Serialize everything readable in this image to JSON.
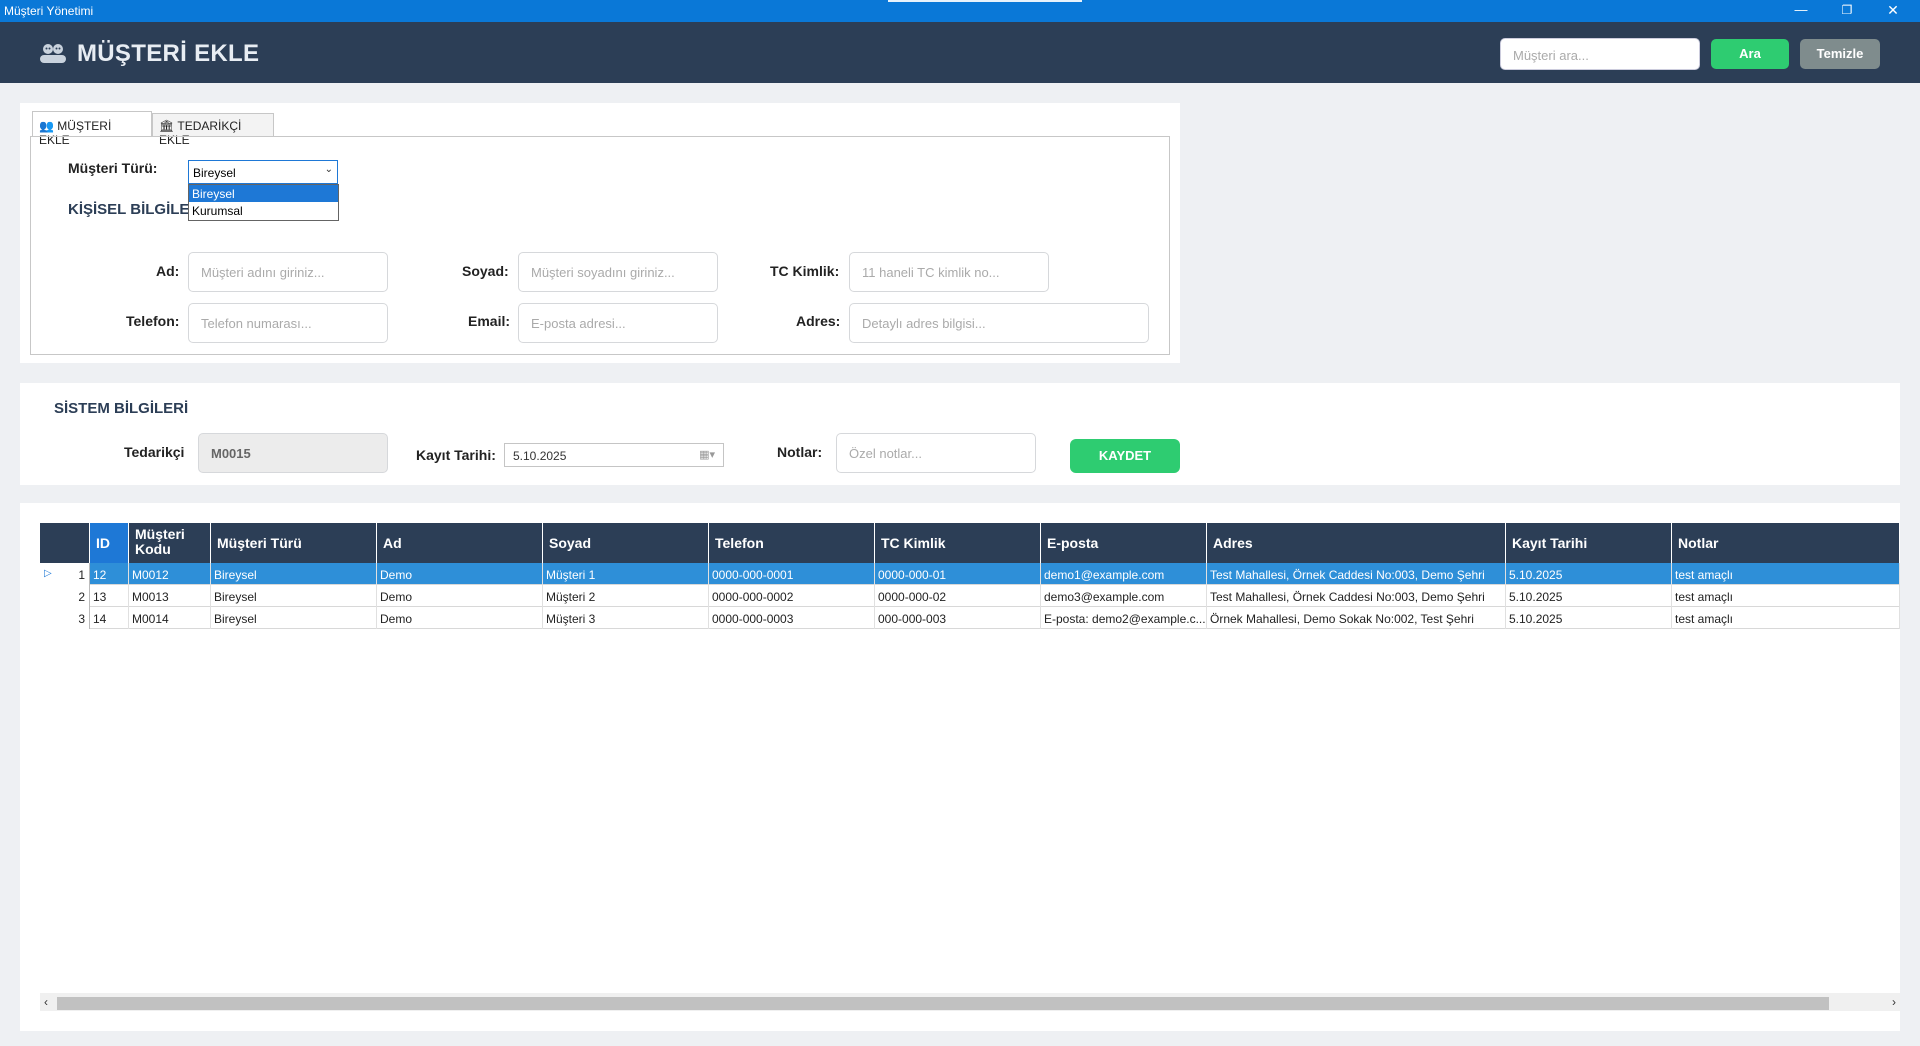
{
  "window": {
    "title": "Müşteri Yönetimi",
    "minimize": "—",
    "maximize": "❐",
    "close": "✕"
  },
  "header": {
    "title": "MÜŞTERİ EKLE",
    "search_placeholder": "Müşteri ara...",
    "search_button": "Ara",
    "clear_button": "Temizle"
  },
  "tabs": [
    {
      "label": "MÜŞTERİ EKLE",
      "active": true
    },
    {
      "label": "TEDARİKÇİ EKLE",
      "active": false
    }
  ],
  "form": {
    "customer_type_label": "Müşteri Türü:",
    "customer_type_value": "Bireysel",
    "customer_type_options": [
      "Bireysel",
      "Kurumsal"
    ],
    "section_personal": "KİŞİSEL BİLGİLER",
    "ad_label": "Ad:",
    "ad_placeholder": "Müşteri adını giriniz...",
    "soyad_label": "Soyad:",
    "soyad_placeholder": "Müşteri soyadını giriniz...",
    "tc_label": "TC Kimlik:",
    "tc_placeholder": "11 haneli TC kimlik no...",
    "telefon_label": "Telefon:",
    "telefon_placeholder": "Telefon numarası...",
    "email_label": "Email:",
    "email_placeholder": "E-posta adresi...",
    "adres_label": "Adres:",
    "adres_placeholder": "Detaylı adres bilgisi..."
  },
  "system": {
    "section_title": "SİSTEM BİLGİLERİ",
    "supplier_label": "Tedarikçi",
    "supplier_value": "M0015",
    "date_label": "Kayıt Tarihi:",
    "date_value": "5.10.2025",
    "notes_label": "Notlar:",
    "notes_placeholder": "Özel notlar...",
    "save_button": "KAYDET"
  },
  "grid": {
    "columns": [
      "ID",
      "Müşteri Kodu",
      "Müşteri Türü",
      "Ad",
      "Soyad",
      "Telefon",
      "TC Kimlik",
      "E-posta",
      "Adres",
      "Kayıt Tarihi",
      "Notlar"
    ],
    "rows": [
      {
        "n": "1",
        "cells": [
          "12",
          "M0012",
          "Bireysel",
          " Demo",
          "Müşteri 1",
          "0000-000-0001",
          "0000-000-01",
          "demo1@example.com",
          "Test Mahallesi, Örnek Caddesi No:003, Demo Şehri",
          "5.10.2025",
          "test amaçlı"
        ]
      },
      {
        "n": "2",
        "cells": [
          "13",
          "M0013",
          "Bireysel",
          "Demo",
          "Müşteri 2",
          "0000-000-0002",
          "0000-000-02",
          " demo3@example.com",
          "Test Mahallesi, Örnek Caddesi No:003, Demo Şehri",
          "5.10.2025",
          "test amaçlı"
        ]
      },
      {
        "n": "3",
        "cells": [
          "14",
          "M0014",
          "Bireysel",
          "Demo",
          "Müşteri 3",
          " 0000-000-0003",
          "000-000-003",
          "E-posta: demo2@example.c...",
          "Örnek Mahallesi, Demo Sokak No:002, Test Şehri",
          "5.10.2025",
          "test amaçlı"
        ]
      }
    ]
  },
  "colors": {
    "titlebar": "#0a78d7",
    "header": "#2c3e56",
    "accent_green": "#2ecc71",
    "selection": "#2e8fd8"
  }
}
